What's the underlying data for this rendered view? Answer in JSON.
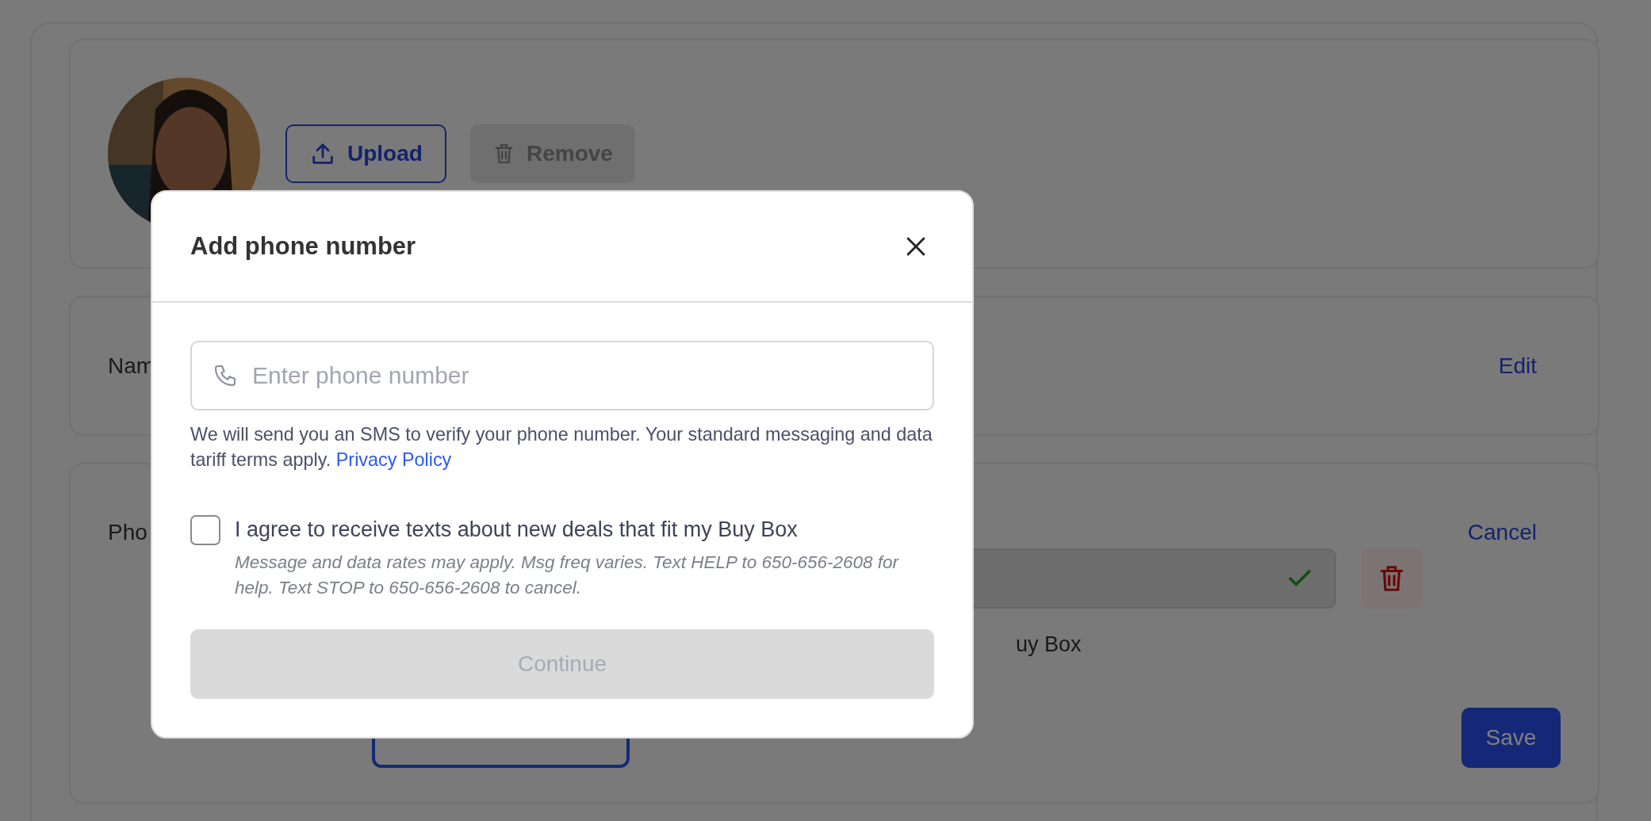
{
  "profile": {
    "upload_button": {
      "label": "Upload",
      "disabled": false
    },
    "remove_button": {
      "label": "Remove",
      "disabled": true
    }
  },
  "name_section": {
    "label": "Nam",
    "action": "Edit"
  },
  "phone_section": {
    "label": "Pho",
    "action": "Cancel",
    "verified": true,
    "consent_fragment": "uy Box",
    "save_button": "Save"
  },
  "modal": {
    "title": "Add phone number",
    "phone_field": {
      "placeholder": "Enter phone number"
    },
    "help_text": "We will send you an SMS to verify your phone number. Your standard messaging and data tariff terms apply.",
    "privacy_link": "Privacy Policy",
    "consent": {
      "label": "I agree to receive texts about new deals that fit my Buy Box",
      "checked": false,
      "note": "Message and data rates may apply. Msg freq varies. Text HELP to 650-656-2608 for help. Text STOP to 650-656-2608 to cancel."
    },
    "continue_button": {
      "label": "Continue",
      "disabled": true
    }
  }
}
